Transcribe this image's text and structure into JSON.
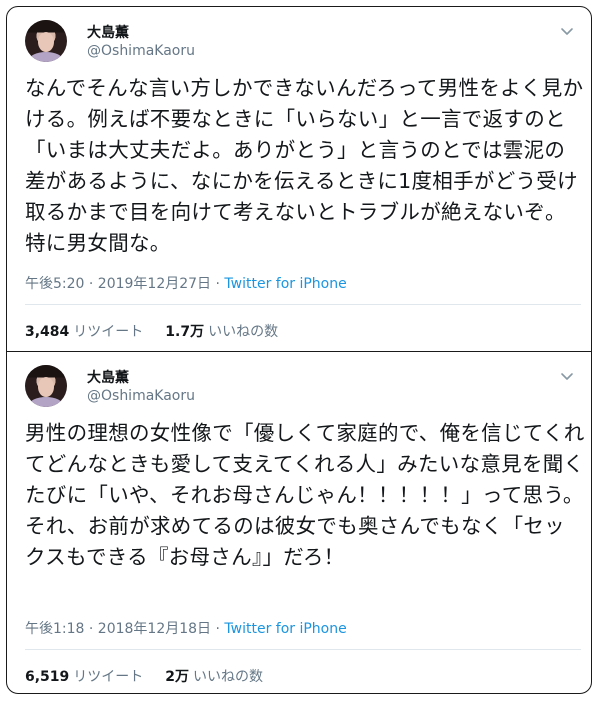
{
  "tweets": [
    {
      "display_name": "大島薫",
      "handle": "@OshimaKaoru",
      "text": "なんでそんな言い方しかできないんだろって男性をよく見かける。例えば不要なときに「いらない」と一言で返すのと「いまは大丈夫だよ。ありがとう」と言うのとでは雲泥の差があるように、なにかを伝えるときに1度相手がどう受け取るかまで目を向けて考えないとトラブルが絶えないぞ。特に男女間な。",
      "time": "午後5:20 · 2019年12月27日",
      "separator": " · ",
      "source": "Twitter for iPhone",
      "retweets": "3,484",
      "retweets_label": "リツイート",
      "likes": "1.7万",
      "likes_label": "いいねの数"
    },
    {
      "display_name": "大島薫",
      "handle": "@OshimaKaoru",
      "text": "男性の理想の女性像で「優しくて家庭的で、俺を信じてくれてどんなときも愛して支えてくれる人」みたいな意見を聞くたびに「いや、それお母さんじゃん！！！！！」って思う。それ、お前が求めてるのは彼女でも奥さんでもなく「セックスもできる『お母さん』」だろ！",
      "time": "午後1:18 · 2018年12月18日",
      "separator": " · ",
      "source": "Twitter for iPhone",
      "retweets": "6,519",
      "retweets_label": "リツイート",
      "likes": "2万",
      "likes_label": "いいねの数"
    }
  ],
  "icons": {
    "menu": "chevron-down-icon",
    "avatar": "profile-photo"
  },
  "colors": {
    "text": "#14171a",
    "secondary": "#657786",
    "link": "#1b95e0",
    "border": "#1a1a1a",
    "divider": "#e1e8ed"
  }
}
